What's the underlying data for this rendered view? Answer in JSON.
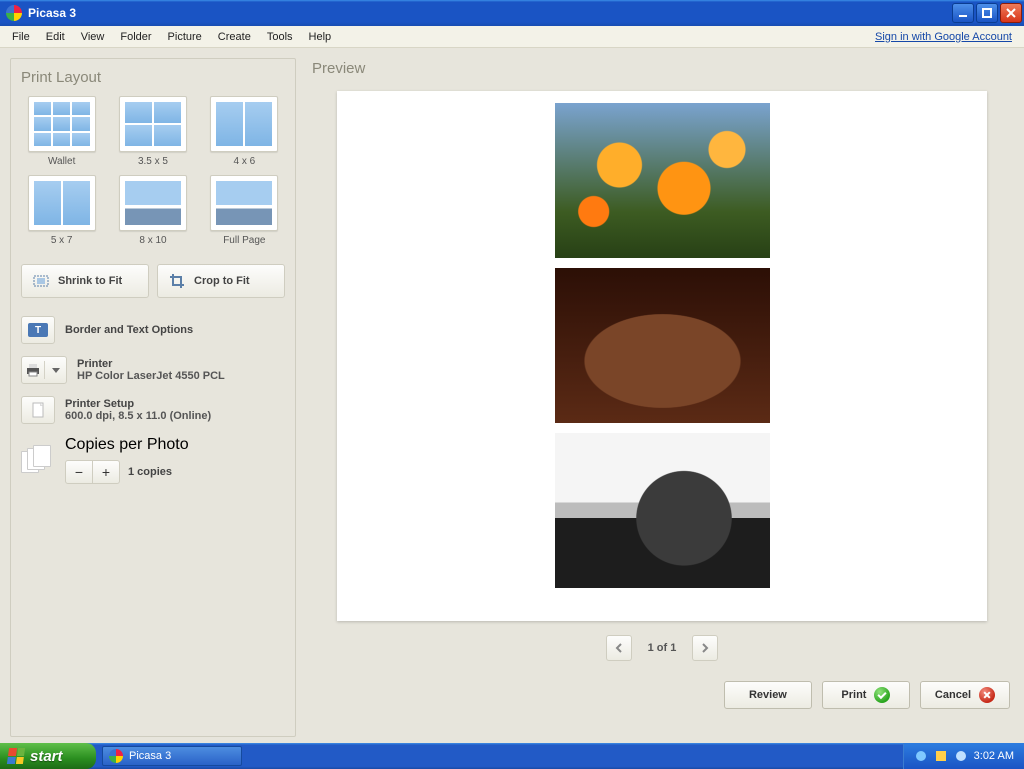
{
  "titlebar": {
    "title": "Picasa 3"
  },
  "menu": {
    "items": [
      "File",
      "Edit",
      "View",
      "Folder",
      "Picture",
      "Create",
      "Tools",
      "Help"
    ],
    "google_link": "Sign in with Google Account"
  },
  "left": {
    "heading": "Print Layout",
    "layouts": [
      {
        "label": "Wallet",
        "grid": "3x3"
      },
      {
        "label": "3.5 x 5",
        "grid": "2x2"
      },
      {
        "label": "4 x 6",
        "grid": "1x2"
      },
      {
        "label": "5 x 7",
        "grid": "1x2"
      },
      {
        "label": "8 x 10",
        "grid": "1x1m"
      },
      {
        "label": "Full Page",
        "grid": "1x1m"
      }
    ],
    "fit": {
      "shrink": "Shrink to Fit",
      "crop": "Crop to Fit"
    },
    "border_text": "Border and Text Options",
    "printer": {
      "label": "Printer",
      "value": "HP Color LaserJet 4550 PCL"
    },
    "printer_setup": {
      "label": "Printer Setup",
      "value": "600.0 dpi, 8.5 x 11.0 (Online)"
    },
    "copies": {
      "label": "Copies per Photo",
      "value": "1 copies"
    }
  },
  "preview": {
    "heading": "Preview",
    "pager": "1 of 1"
  },
  "footer": {
    "review": "Review",
    "print": "Print",
    "cancel": "Cancel"
  },
  "taskbar": {
    "start": "start",
    "task": "Picasa 3",
    "clock": "3:02 AM"
  }
}
